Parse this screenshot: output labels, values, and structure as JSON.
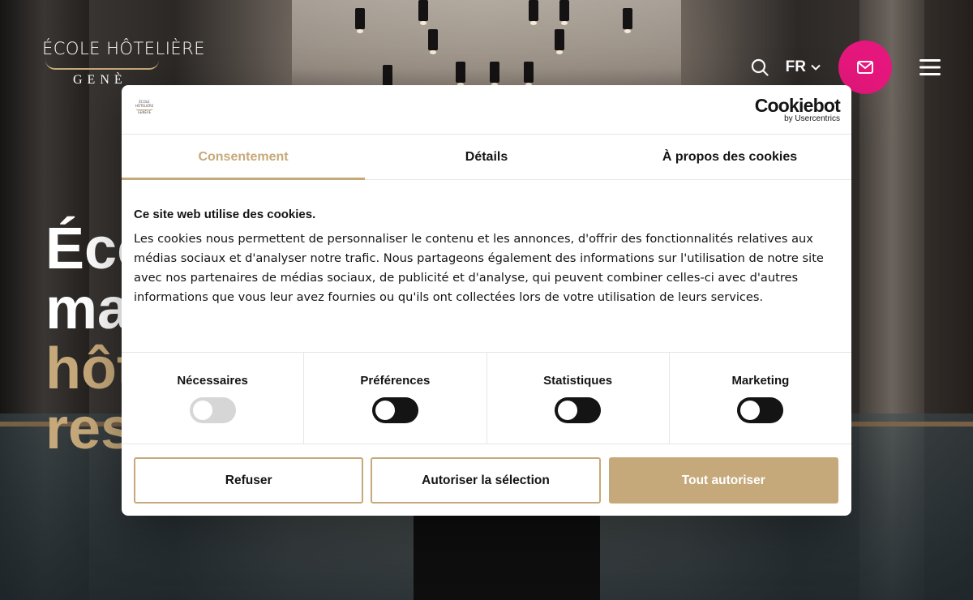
{
  "site": {
    "logo": {
      "line1": "ÉCOLE HÔTELIÈRE",
      "line2": "GENÈ"
    },
    "nav": {
      "language": "FR",
      "icons": {
        "search": "search-icon",
        "lang_dropdown": "chevron-down-icon",
        "contact": "mail-icon",
        "menu": "hamburger-menu-icon"
      },
      "accent_color": "#e6177c"
    },
    "hero": {
      "line1": "Éco",
      "line2": "ma",
      "line3": "hôt",
      "line4": "res",
      "accent_color": "#c6a97a"
    }
  },
  "cookie_dialog": {
    "brand": {
      "logo_mini": [
        "ÉCOLE",
        "HÔTELIÈRE",
        "GENÈVE"
      ],
      "provider_name": "Cookiebot",
      "provider_sub": "by Usercentrics"
    },
    "tabs": [
      {
        "label": "Consentement",
        "active": true
      },
      {
        "label": "Détails",
        "active": false
      },
      {
        "label": "À propos des cookies",
        "active": false
      }
    ],
    "heading": "Ce site web utilise des cookies.",
    "description": "Les cookies nous permettent de personnaliser le contenu et les annonces, d'offrir des fonctionnalités relatives aux médias sociaux et d'analyser notre trafic. Nous partageons également des informations sur l'utilisation de notre site avec nos partenaires de médias sociaux, de publicité et d'analyse, qui peuvent combiner celles-ci avec d'autres informations que vous leur avez fournies ou qu'ils ont collectées lors de votre utilisation de leurs services.",
    "categories": [
      {
        "label": "Nécessaires",
        "enabled": false,
        "locked": true
      },
      {
        "label": "Préférences",
        "enabled": false,
        "locked": false
      },
      {
        "label": "Statistiques",
        "enabled": false,
        "locked": false
      },
      {
        "label": "Marketing",
        "enabled": false,
        "locked": false
      }
    ],
    "buttons": {
      "refuse": "Refuser",
      "allow_selection": "Autoriser la sélection",
      "allow_all": "Tout autoriser"
    },
    "accent_color": "#c6a97a"
  }
}
